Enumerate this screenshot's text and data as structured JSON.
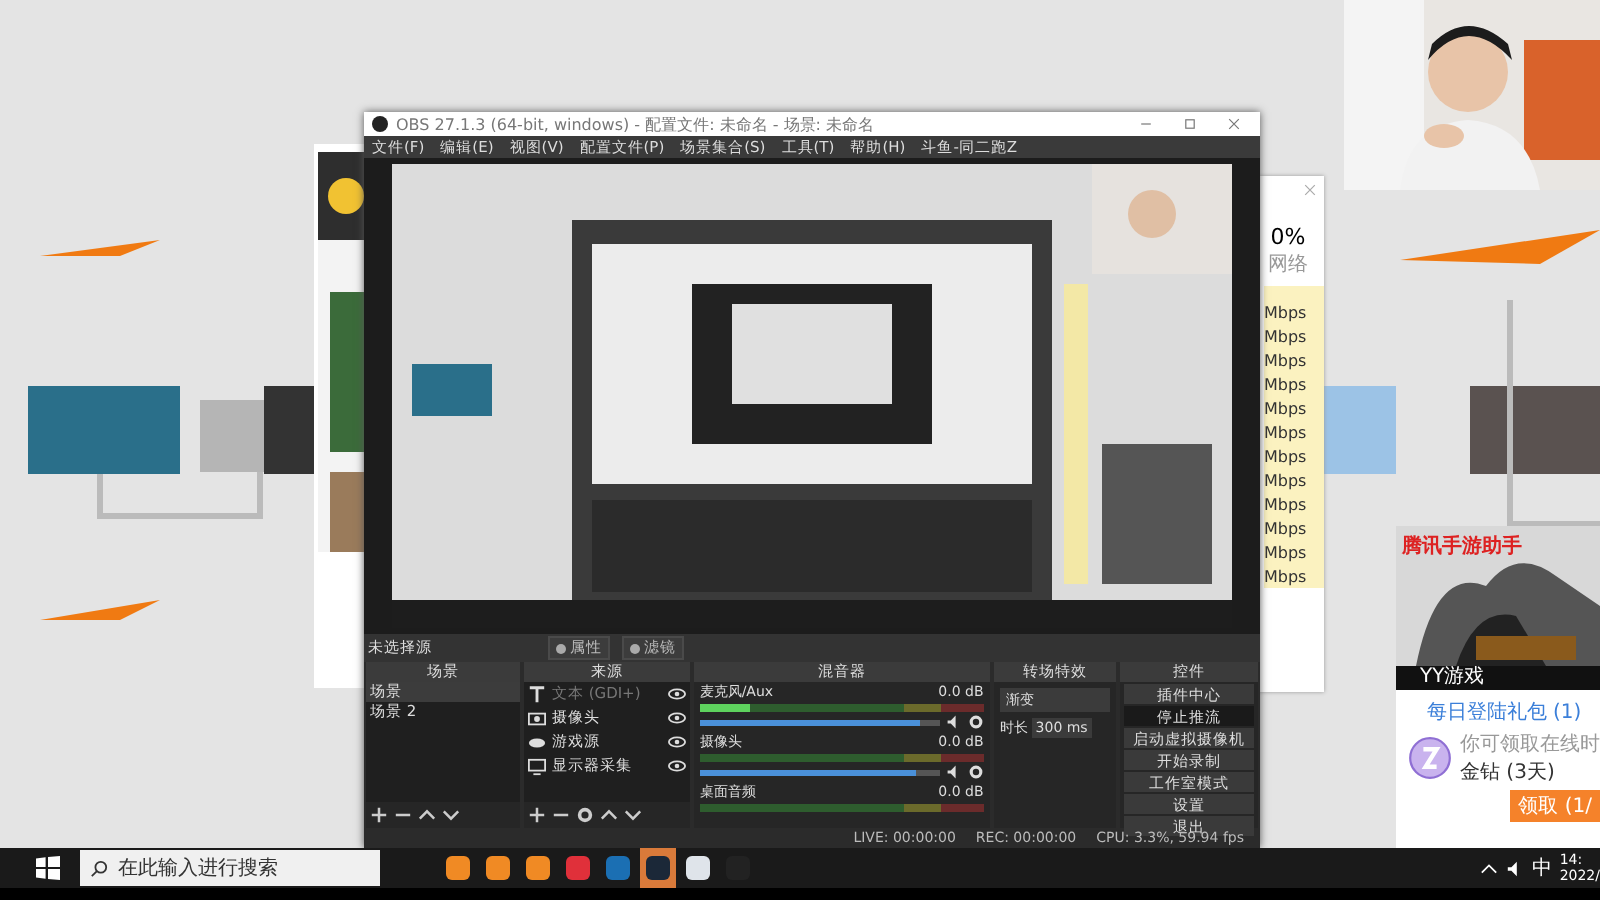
{
  "obs": {
    "title": "OBS 27.1.3 (64-bit, windows) - 配置文件: 未命名 - 场景: 未命名",
    "menu": [
      "文件(F)",
      "编辑(E)",
      "视图(V)",
      "配置文件(P)",
      "场景集合(S)",
      "工具(T)",
      "帮助(H)",
      "斗鱼-同二跑Z"
    ],
    "no_source_label": "未选择源",
    "source_buttons": [
      "属性",
      "滤镜"
    ],
    "scenes": {
      "title": "场景",
      "items": [
        {
          "label": "场景",
          "selected": true
        },
        {
          "label": "场景 2",
          "selected": false
        }
      ]
    },
    "sources": {
      "title": "来源",
      "items": [
        {
          "kind": "text",
          "label": "文本 (GDI+)",
          "visible": false
        },
        {
          "kind": "camera",
          "label": "摄像头",
          "visible": true
        },
        {
          "kind": "game",
          "label": "游戏源",
          "visible": true
        },
        {
          "kind": "display",
          "label": "显示器采集",
          "visible": true
        }
      ]
    },
    "mixer": {
      "title": "混音器",
      "channels": [
        {
          "name": "麦克风/Aux",
          "reading": "0.0 dB",
          "signal": true,
          "level": 0.92
        },
        {
          "name": "摄像头",
          "reading": "0.0 dB",
          "signal": false,
          "level": 0.9
        },
        {
          "name": "桌面音频",
          "reading": "0.0 dB",
          "signal": false
        }
      ]
    },
    "transitions": {
      "title": "转场特效",
      "selected": "渐变",
      "duration_label": "时长",
      "duration": "300 ms"
    },
    "controls": {
      "title": "控件",
      "buttons": [
        {
          "label": "插件中心",
          "active": false
        },
        {
          "label": "停止推流",
          "active": true
        },
        {
          "label": "启动虚拟摄像机",
          "active": false
        },
        {
          "label": "开始录制",
          "active": false
        },
        {
          "label": "工作室模式",
          "active": false
        },
        {
          "label": "设置",
          "active": false
        },
        {
          "label": "退出",
          "active": false
        }
      ]
    },
    "status": {
      "live": "LIVE: 00:00:00",
      "rec": "REC: 00:00:00",
      "cpu": "CPU: 3.3%, 59.94 fps"
    }
  },
  "network_panel": {
    "percent": "0%",
    "label": "网络",
    "rates": [
      "Mbps",
      "Mbps",
      "Mbps",
      "Mbps",
      "Mbps",
      "Mbps",
      "Mbps",
      "Mbps",
      "Mbps",
      "Mbps",
      "Mbps",
      "Mbps"
    ]
  },
  "game_popup": {
    "brand": "腾讯手游助手",
    "bar_title": "YY游戏",
    "heading": "每日登陆礼包 (1)",
    "note": "你可领取在线时",
    "reward": "金钻 (3天)",
    "button": "领取 (1/"
  },
  "taskbar": {
    "search_placeholder": "在此输入进行搜索",
    "apps": [
      {
        "kind": "orange",
        "selected": false
      },
      {
        "kind": "orange",
        "selected": false
      },
      {
        "kind": "orange",
        "selected": false
      },
      {
        "kind": "red",
        "selected": false
      },
      {
        "kind": "blue",
        "selected": false
      },
      {
        "kind": "steam",
        "selected": true
      },
      {
        "kind": "pc",
        "selected": false
      },
      {
        "kind": "obs",
        "selected": false
      }
    ],
    "ime": "中",
    "clock": "14:",
    "date": "2022/"
  }
}
